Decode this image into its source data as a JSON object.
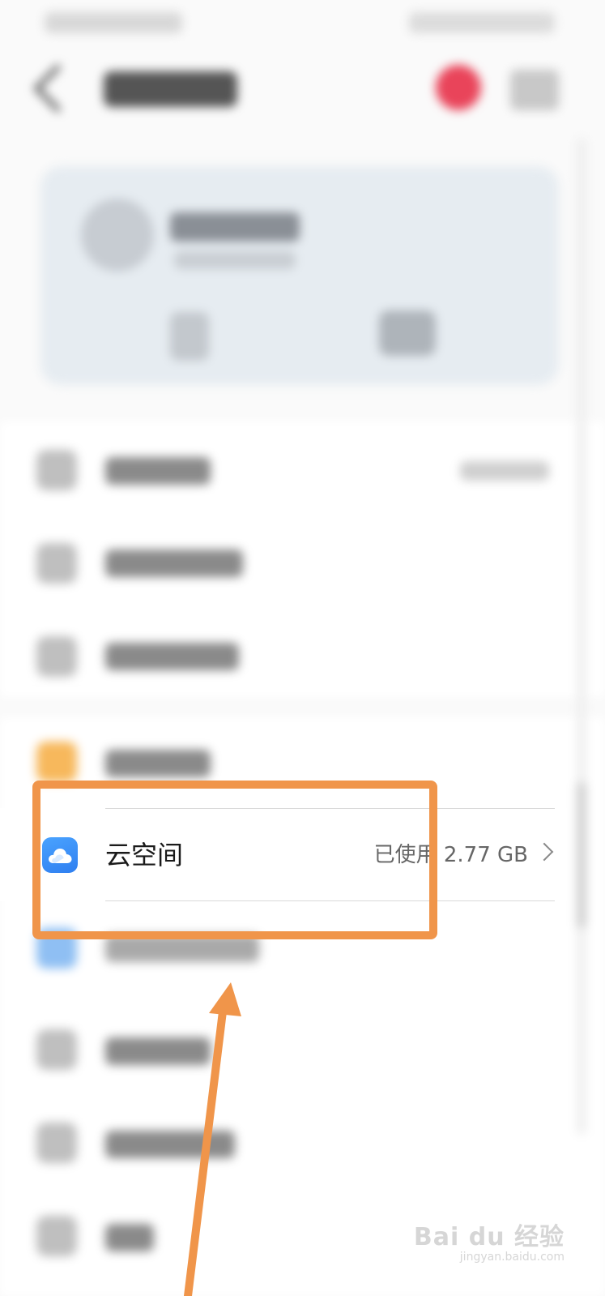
{
  "cloud_row": {
    "label": "云空间",
    "usage": "已使用 2.77 GB",
    "icon": "cloud-icon"
  },
  "watermark": {
    "logo": "Bai du 经验",
    "sub": "jingyan.baidu.com"
  },
  "colors": {
    "annotation": "#f0954a",
    "cloud_icon": "#2f7ff0",
    "badge": "#e9445a"
  }
}
